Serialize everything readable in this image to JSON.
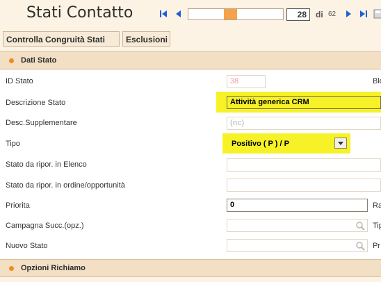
{
  "header": {
    "title": "Stati Contatto",
    "page_current": "28",
    "page_of_label": "di",
    "page_total": "62",
    "position_fraction": 0.44
  },
  "actions": {
    "check_label": "Controlla Congruità Stati",
    "exclusions_label": "Esclusioni"
  },
  "section_data": {
    "title": "Dati Stato"
  },
  "section_recall": {
    "title": "Opzioni Richiamo"
  },
  "fields": {
    "id_label": "ID Stato",
    "id_value": "38",
    "side_bl": "Blo",
    "descr_label": "Descrizione Stato",
    "descr_value": "Attività generica CRM",
    "desc_supp_label": "Desc.Supplementare",
    "desc_supp_value": "(nc)",
    "tipo_label": "Tipo",
    "tipo_value": "Positivo ( P ) / P",
    "stato_elenco_label": "Stato da ripor. in Elenco",
    "stato_ordine_label": "Stato da ripor. in ordine/opportunità",
    "priorita_label": "Priorita",
    "priorita_value": "0",
    "side_ra": "Ra",
    "campagna_label": "Campagna Succ.(opz.)",
    "side_tip": "Tip",
    "nuovo_stato_label": "Nuovo Stato",
    "side_pr": "Pr"
  },
  "colors": {
    "accent": "#f08c1a",
    "highlight": "#f7f227",
    "nav_blue": "#1f5fd6",
    "id_value_color": "#f19a9a"
  },
  "icons": {
    "first": "first-page-icon",
    "prev": "prev-page-icon",
    "next": "next-page-icon",
    "last": "last-page-icon",
    "save": "save-icon",
    "lookup": "magnifier-icon",
    "dropdown": "chevron-down-icon"
  }
}
